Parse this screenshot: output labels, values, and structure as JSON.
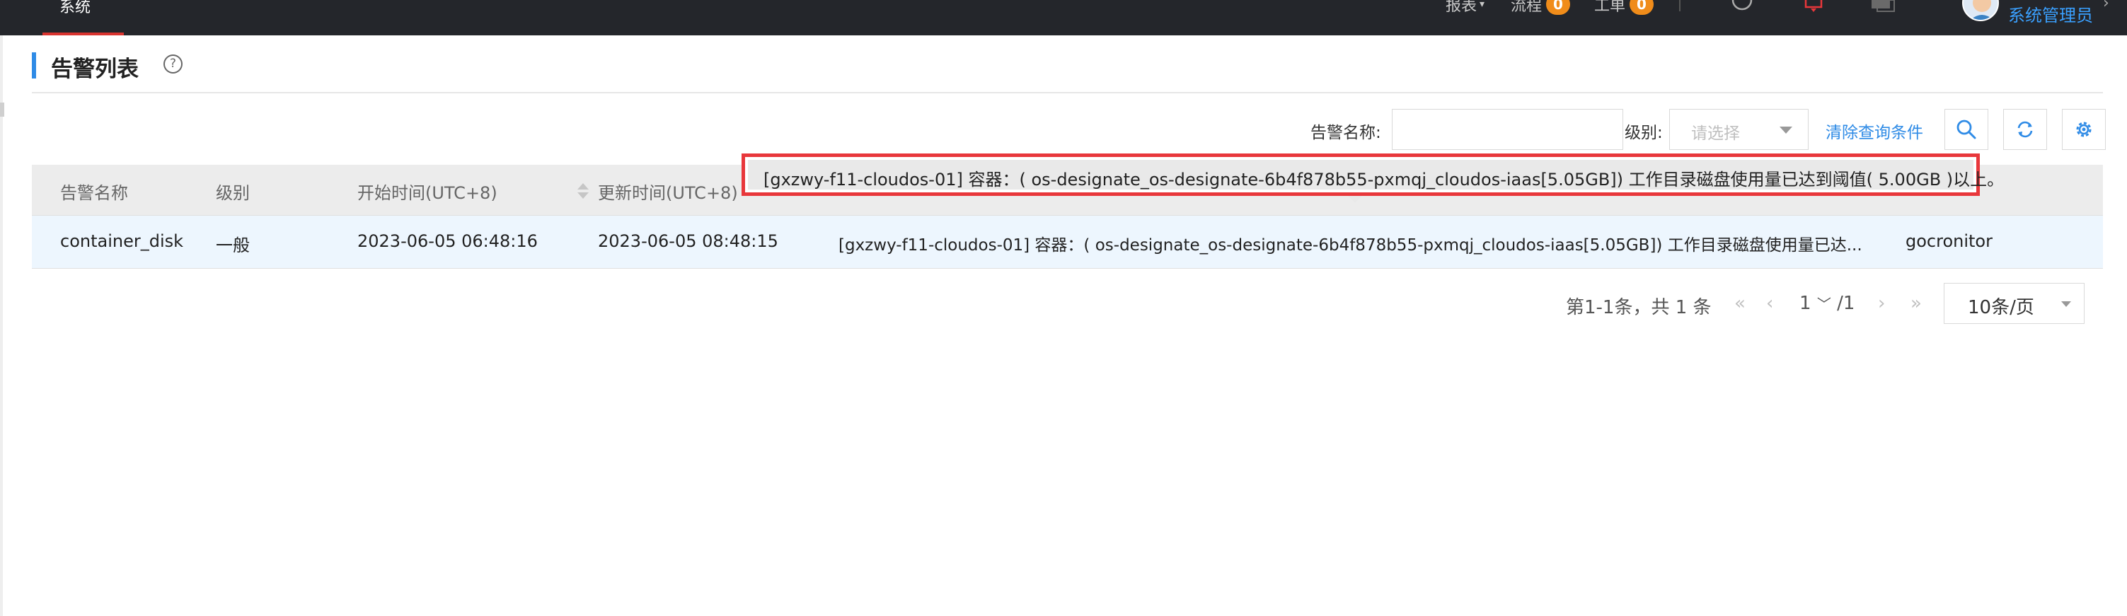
{
  "topbar": {
    "active_tab": "系统",
    "menu_report": "报表",
    "menu_flow": "流程",
    "flow_count": "0",
    "menu_ticket": "工单",
    "ticket_count": "0",
    "user_name": "系统管理员"
  },
  "page": {
    "title": "告警列表",
    "help_glyph": "?"
  },
  "search": {
    "name_label": "告警名称:",
    "name_value": "",
    "level_label": "级别:",
    "level_placeholder": "请选择",
    "clear_label": "清除查询条件"
  },
  "table": {
    "columns": [
      "告警名称",
      "级别",
      "开始时间(UTC+8)",
      "更新时间(UTC+8)"
    ],
    "rows": [
      {
        "name": "container_disk",
        "level": "一般",
        "start_time": "2023-06-05 06:48:16",
        "update_time": "2023-06-05 08:48:15",
        "content": "[gxzwy-f11-cloudos-01] 容器：( os-designate_os-designate-6b4f878b55-pxmqj_cloudos-iaas[5.05GB]) 工作目录磁盘使用量已达...",
        "source": "gocronitor"
      }
    ]
  },
  "tooltip": {
    "text": "[gxzwy-f11-cloudos-01] 容器：( os-designate_os-designate-6b4f878b55-pxmqj_cloudos-iaas[5.05GB]) 工作目录磁盘使用量已达到阈值( 5.00GB )以上。"
  },
  "pagination": {
    "summary": "第1-1条，共 1 条",
    "current_page": "1",
    "total_pages": "/1",
    "page_size": "10条/页"
  },
  "colors": {
    "topbar_bg": "#24262b",
    "accent_blue": "#2f8be6",
    "badge_orange": "#f08c1a",
    "highlight_red": "#e8373b",
    "row_highlight": "#edf6fe"
  }
}
